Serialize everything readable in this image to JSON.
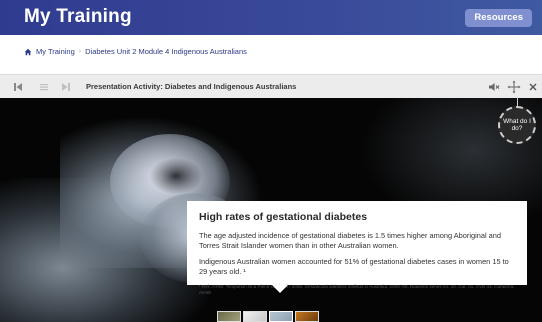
{
  "header": {
    "title": "My Training",
    "resources_label": "Resources"
  },
  "breadcrumb": {
    "items": [
      "My Training",
      "Diabetes Unit 2 Module 4 Indigenous Australians"
    ]
  },
  "toolbar": {
    "title": "Presentation Activity: Diabetes and Indigenous Australians"
  },
  "help": {
    "label": "What do I do?"
  },
  "card": {
    "heading": "High rates of gestational diabetes",
    "para1": "The age adjusted incidence of gestational diabetes is 1.5 times higher among Aboriginal and Torres Strait Islander women than in other Australian women.",
    "para2": "Indigenous Australian women accounted for 51% of gestational diabetes cases in women 15 to 29 years old. ¹",
    "reference": "¹ Ref: AIHW: Templeton M & Pieris-Caldwell I 2008. Gestational diabetes mellitus in Australia, 2005–06. Diabetes series no. 10. Cat. no. CVD 44. Canberra: AIHW."
  },
  "icons": {
    "home": "home-icon",
    "first": "skip-to-start-icon",
    "list": "list-icon",
    "last": "skip-to-end-icon",
    "mute": "mute-icon",
    "fullscreen": "move-arrows-icon",
    "close": "close-icon"
  }
}
